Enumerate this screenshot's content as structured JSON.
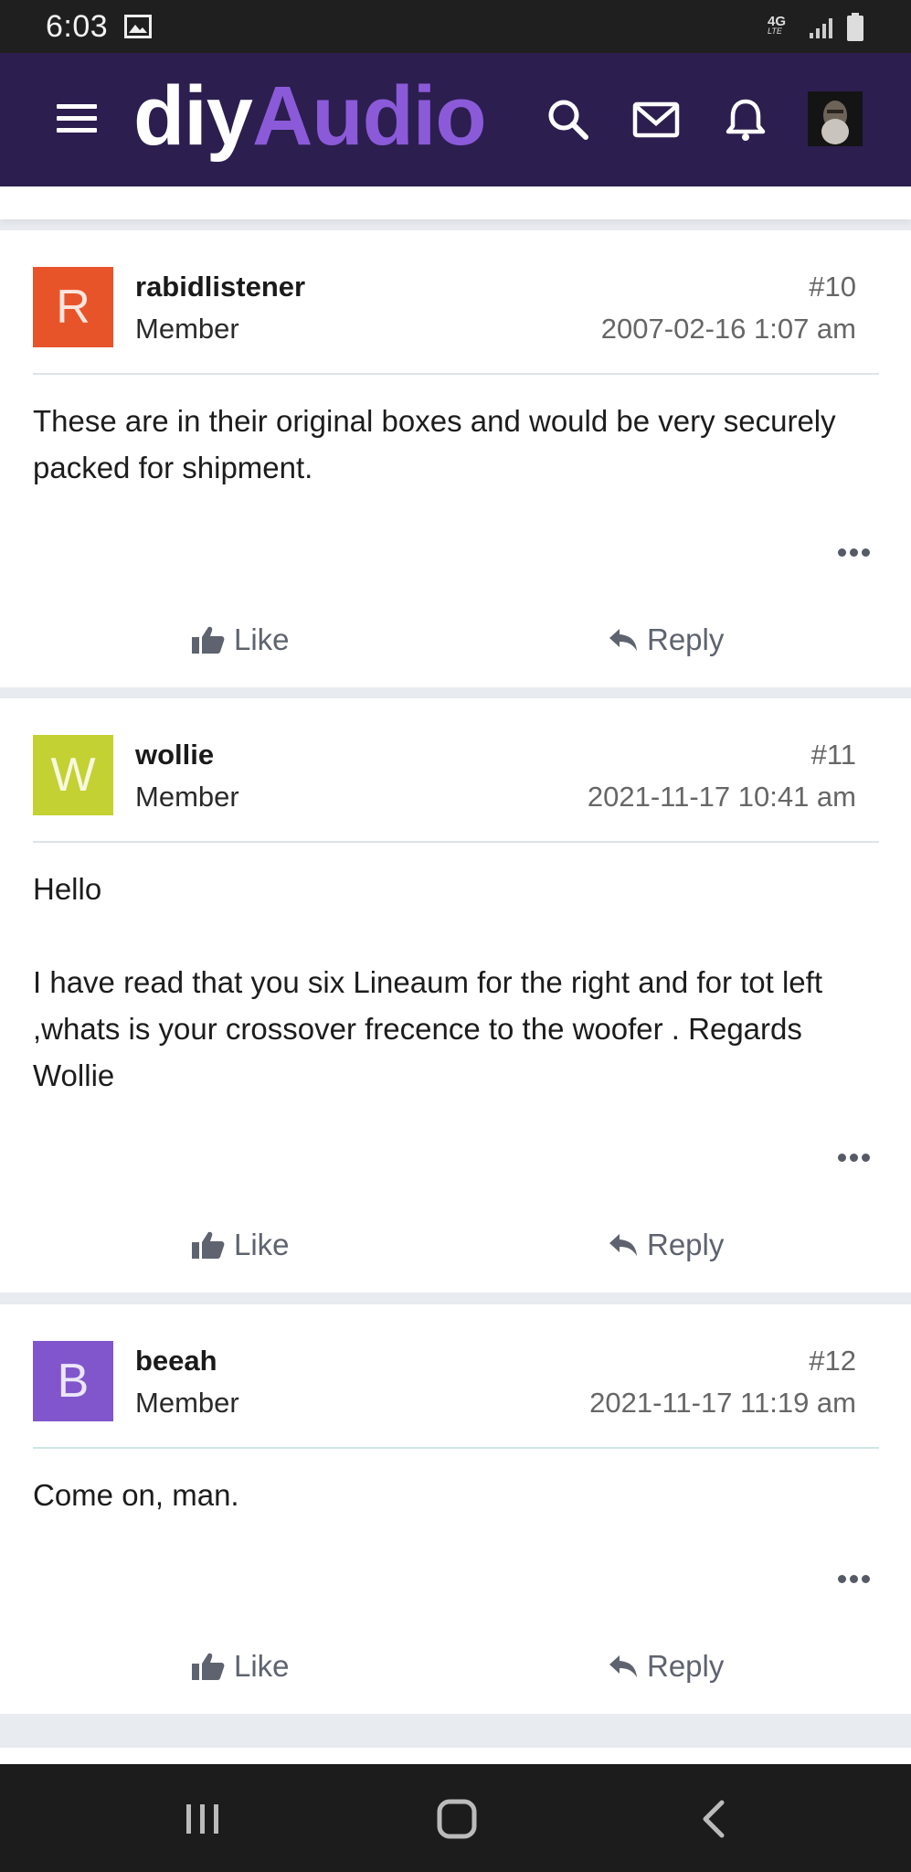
{
  "status_bar": {
    "time": "6:03",
    "network": "4G",
    "network_sub": "LTE"
  },
  "header": {
    "logo_part1": "diy",
    "logo_part2": "Audio",
    "brand_color": "#2c1e4f",
    "accent_color": "#8b5ad8"
  },
  "posts": [
    {
      "avatar_letter": "R",
      "avatar_color": "#e8542a",
      "username": "rabidlistener",
      "role": "Member",
      "number": "#10",
      "date": "2007-02-16 1:07 am",
      "body": [
        "These are in their original boxes and would be very securely packed for shipment."
      ],
      "like_label": "Like",
      "reply_label": "Reply"
    },
    {
      "avatar_letter": "W",
      "avatar_color": "#c4d132",
      "username": "wollie",
      "role": "Member",
      "number": "#11",
      "date": "2021-11-17 10:41 am",
      "body": [
        "Hello",
        "I have read that you six Lineaum for the right and for tot left ,whats is your crossover frecence to the woofer . Regards Wollie"
      ],
      "like_label": "Like",
      "reply_label": "Reply"
    },
    {
      "avatar_letter": "B",
      "avatar_color": "#8156cc",
      "username": "beeah",
      "role": "Member",
      "number": "#12",
      "date": "2021-11-17 11:19 am",
      "body": [
        "Come on, man."
      ],
      "like_label": "Like",
      "reply_label": "Reply"
    }
  ]
}
